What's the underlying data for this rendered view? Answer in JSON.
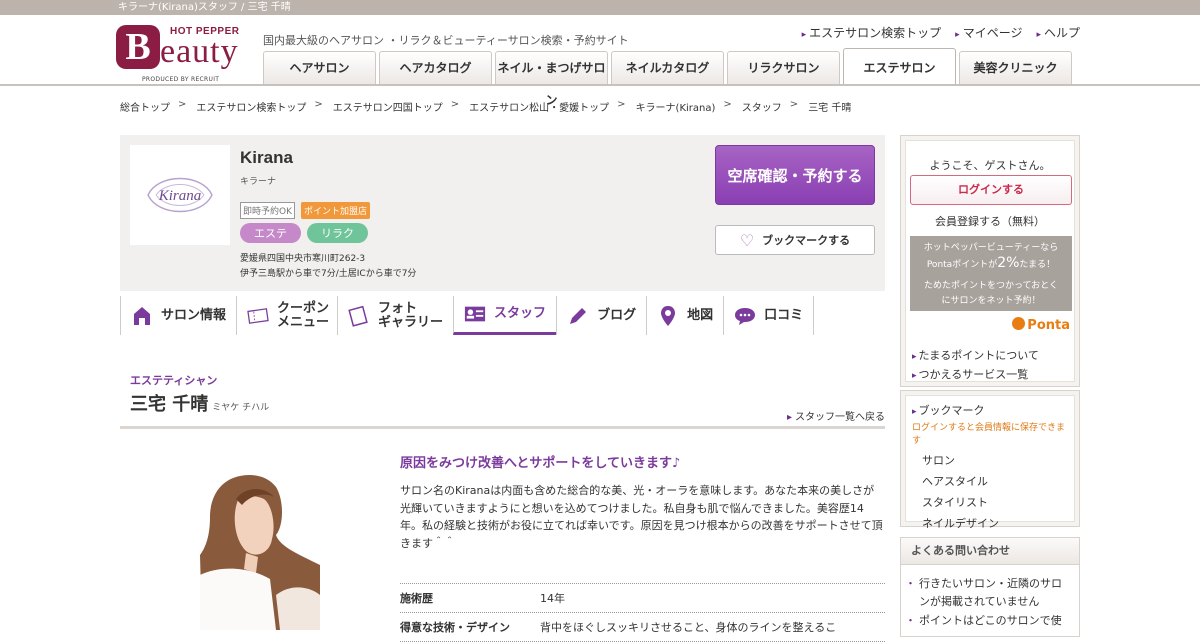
{
  "topstrip": "キラーナ(Kirana)スタッフ / 三宅 千晴",
  "logo": {
    "hotpepper": "HOT PEPPER",
    "b": "B",
    "eauty": "eauty",
    "produced": "PRODUCED BY RECRUIT"
  },
  "header": {
    "tagline": "国内最大級のヘアサロン ・リラク＆ビューティーサロン検索・予約サイト",
    "links": [
      "エステサロン検索トップ",
      "マイページ",
      "ヘルプ"
    ]
  },
  "gnav": [
    "ヘアサロン",
    "ヘアカタログ",
    "ネイル・まつげサロン",
    "ネイルカタログ",
    "リラクサロン",
    "エステサロン",
    "美容クリニック"
  ],
  "breadcrumb": [
    "総合トップ",
    "エステサロン検索トップ",
    "エステサロン四国トップ",
    "エステサロン松山・愛媛トップ",
    "キラーナ(Kirana)",
    "スタッフ",
    "三宅 千晴"
  ],
  "salon": {
    "logo_text": "Kirana",
    "name": "Kirana",
    "kana": "キラーナ",
    "tag_instant": "即時予約OK",
    "tag_point": "ポイント加盟店",
    "genre1": "エステ",
    "genre2": "リラク",
    "address": "愛媛県四国中央市寒川町262-3",
    "access": "伊予三島駅から車で7分/土居ICから車で7分",
    "reserve_label": "空席確認・予約する",
    "bookmark_label": "ブックマークする"
  },
  "tabs": [
    {
      "label": "サロン情報",
      "icon": "house-icon"
    },
    {
      "label": "クーポン\nメニュー",
      "icon": "coupon-icon"
    },
    {
      "label": "フォト\nギャラリー",
      "icon": "photo-icon"
    },
    {
      "label": "スタッフ",
      "icon": "staff-card-icon"
    },
    {
      "label": "ブログ",
      "icon": "pen-icon"
    },
    {
      "label": "地図",
      "icon": "map-pin-icon"
    },
    {
      "label": "口コミ",
      "icon": "chat-bubble-icon"
    }
  ],
  "staff": {
    "role": "エステティシャン",
    "name": "三宅 千晴",
    "name_kana": "ミヤケ チハル",
    "back_link": "スタッフ一覧へ戻る",
    "catch": "原因をみつけ改善へとサポートをしていきます♪",
    "comment": "サロン名のKiranaは内面も含めた総合的な美、光・オーラを意味します。あなた本来の美しさが光輝いていきますようにと想いを込めてつけました。私自身も肌で悩んできました。美容歴14年。私の経験と技術がお役に立てれば幸いです。原因を見つけ根本からの改善をサポートさせて頂きます＾＾",
    "info": [
      {
        "key": "施術歴",
        "value": "14年"
      },
      {
        "key": "得意な技術・デザイン",
        "value": "背中をほぐしスッキリさせること、身体のラインを整えるこ"
      }
    ]
  },
  "sidebar": {
    "welcome": "ようこそ、ゲストさん。",
    "login": "ログインする",
    "register": "会員登録する（無料）",
    "ponta_line1": "ホットペッパービューティーなら",
    "ponta_line2a": "Pontaポイントが",
    "ponta_line2b": "2%",
    "ponta_line2c": "たまる！",
    "ponta_line3": "ためたポイントをつかっておとく",
    "ponta_line4": "にサロンをネット予約！",
    "ponta_logo": "Ponta",
    "point_links": [
      "たまるポイントについて",
      "つかえるサービス一覧"
    ],
    "bookmark_title": "ブックマーク",
    "bookmark_note": "ログインすると会員情報に保存できます",
    "bookmark_items": [
      "サロン",
      "ヘアスタイル",
      "スタイリスト",
      "ネイルデザイン"
    ],
    "faq_title": "よくある問い合わせ",
    "faq_items": [
      "行きたいサロン・近隣のサロンが掲載されていません",
      "ポイントはどこのサロンで使"
    ]
  },
  "colors": {
    "brand": "#8b1d45",
    "accent": "#7b3b9c",
    "reserve": "#9a4fbc"
  }
}
